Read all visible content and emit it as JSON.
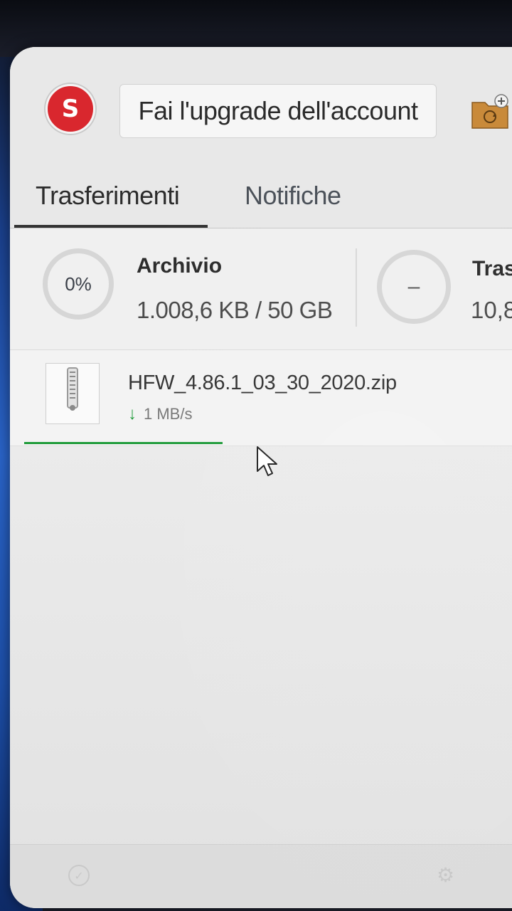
{
  "header": {
    "avatar_initial": "S",
    "avatar_color": "#d9272e",
    "upgrade_label": "Fai l'upgrade dell'account",
    "folder_icon": "folder-sync-add-icon"
  },
  "tabs": [
    {
      "label": "Trasferimenti",
      "active": true
    },
    {
      "label": "Notifiche",
      "active": false
    }
  ],
  "storage": {
    "percent_label": "0%",
    "title": "Archivio",
    "usage": "1.008,6 KB / 50 GB"
  },
  "transfer": {
    "ring_label": "–",
    "title": "Tras",
    "value": "10,8"
  },
  "transfers": [
    {
      "file_name": "HFW_4.86.1_03_30_2020.zip",
      "speed": "1 MB/s",
      "direction_icon": "download-arrow-icon",
      "file_type_icon": "zip-file-icon",
      "progress": 0.41
    }
  ],
  "colors": {
    "accent_green": "#1f9b3a",
    "brand_red": "#d9272e"
  }
}
